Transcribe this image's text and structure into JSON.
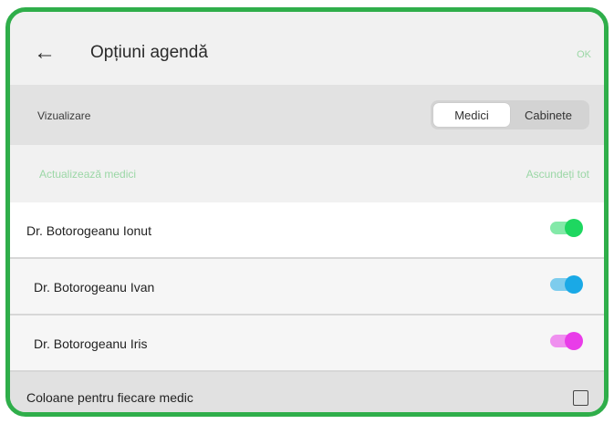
{
  "header": {
    "back_icon": "←",
    "title": "Opțiuni agendă",
    "ok_label": "OK"
  },
  "view": {
    "label": "Vizualizare",
    "options": [
      {
        "label": "Medici",
        "selected": true
      },
      {
        "label": "Cabinete",
        "selected": false
      }
    ]
  },
  "actions": {
    "update_label": "Actualizează medici",
    "hide_all_label": "Ascundeți tot",
    "accent_color": "#9bd7a6"
  },
  "doctors": [
    {
      "name": "Dr. Botorogeanu Ionut",
      "enabled": true,
      "color": "#1ed760"
    },
    {
      "name": "Dr. Botorogeanu  Ivan",
      "enabled": true,
      "color": "#1aa9e6"
    },
    {
      "name": "Dr. Botorogeanu Iris",
      "enabled": true,
      "color": "#e93ce9"
    }
  ],
  "footer": {
    "label": "Coloane pentru fiecare medic",
    "checked": false
  }
}
